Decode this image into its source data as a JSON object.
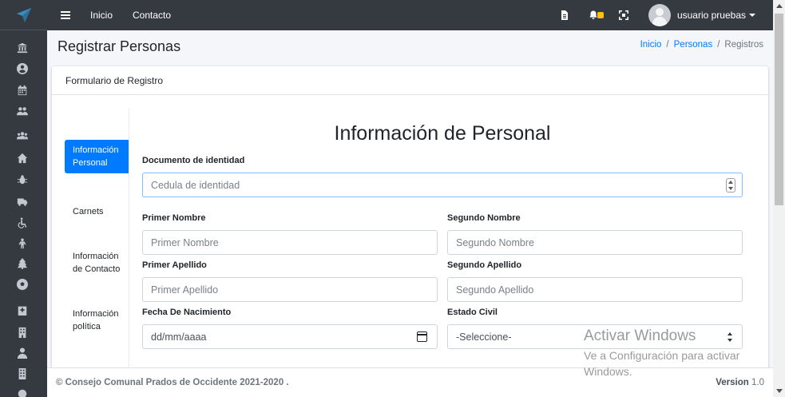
{
  "navbar": {
    "links": [
      "Inicio",
      "Contacto"
    ],
    "user_name": "usuario pruebas"
  },
  "header": {
    "title": "Registrar Personas",
    "breadcrumb": [
      "Inicio",
      "Personas",
      "Registros"
    ]
  },
  "card": {
    "header": "Formulario de Registro",
    "tabs": [
      "Información Personal",
      "Carnets",
      "Información de Contacto",
      "Información política"
    ],
    "form_title": "Información de Personal",
    "fields": {
      "documento": {
        "label": "Documento de identidad",
        "placeholder": "Cedula de identidad"
      },
      "primer_nombre": {
        "label": "Primer Nombre",
        "placeholder": "Primer Nombre"
      },
      "segundo_nombre": {
        "label": "Segundo Nombre",
        "placeholder": "Segundo Nombre"
      },
      "primer_apellido": {
        "label": "Primer Apellido",
        "placeholder": "Primer Apellido"
      },
      "segundo_apellido": {
        "label": "Segundo Apellido",
        "placeholder": "Segundo Apellido"
      },
      "fecha_nacimiento": {
        "label": "Fecha De Nacimiento",
        "value": "dd/mm/aaaa"
      },
      "estado_civil": {
        "label": "Estado Civil",
        "value": "-Seleccione-"
      }
    }
  },
  "footer": {
    "copyright": "© Consejo Comunal Prados de Occidente 2021-2020 .",
    "version_label": "Version",
    "version_number": "1.0"
  },
  "watermark": {
    "title": "Activar Windows",
    "subtitle": "Ve a Configuración para activar Windows."
  },
  "colors": {
    "sidebar": "#343a40",
    "primary": "#007bff",
    "badge": "#ffc107"
  }
}
